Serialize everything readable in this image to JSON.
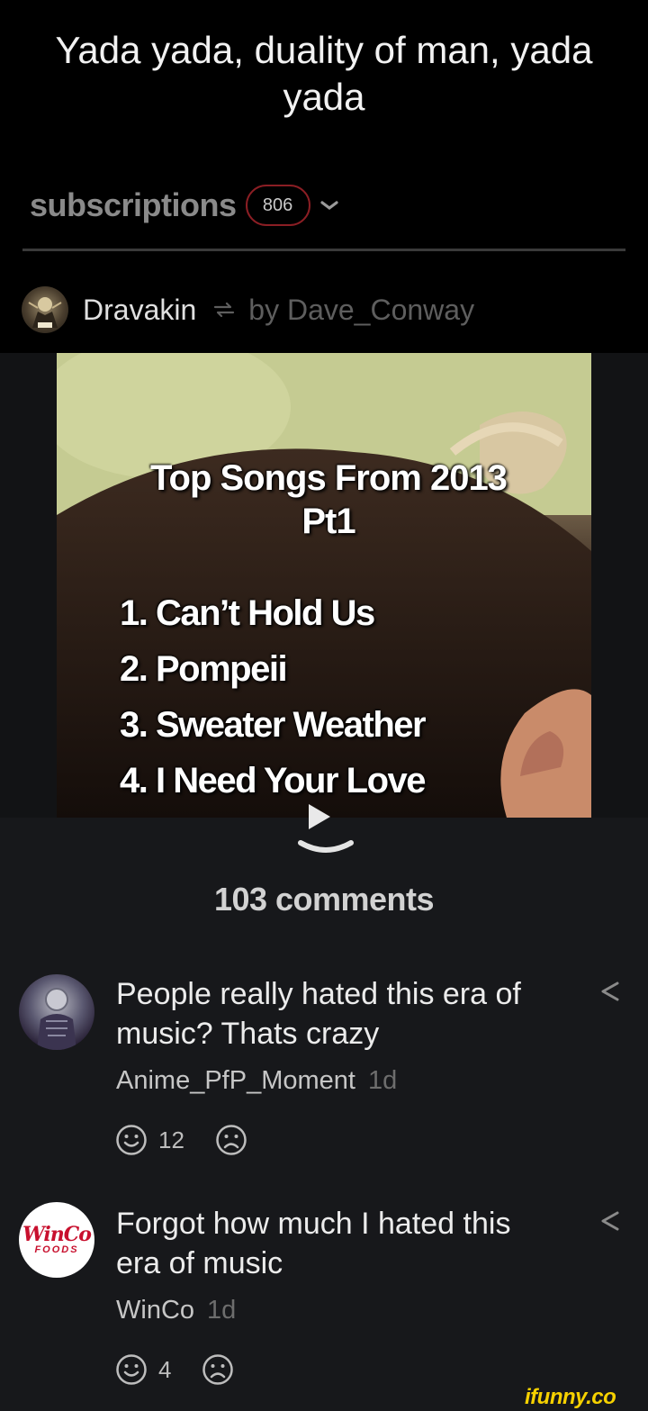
{
  "post": {
    "title": "Yada yada, duality of man, yada yada",
    "author": "Dravakin",
    "reposted_by": "by Dave_Conway"
  },
  "subscriptions": {
    "label": "subscriptions",
    "count": "806"
  },
  "media": {
    "overlay_title": "Top Songs From 2013 Pt1",
    "songs": [
      "1. Can’t Hold Us",
      "2. Pompeii",
      "3. Sweater Weather",
      "4. I Need Your Love"
    ]
  },
  "comments_header": "103 comments",
  "comments": [
    {
      "text": "People really hated this era of music? Thats crazy",
      "user": "Anime_PfP_Moment",
      "time": "1d",
      "smiles": "12"
    },
    {
      "text": "Forgot how much I hated this era of music",
      "user": "WinCo",
      "time": "1d",
      "smiles": "4",
      "avatar_logo_main": "WinCo",
      "avatar_logo_sub": "FOODS"
    }
  ],
  "watermark": "ifunny.co",
  "colors": {
    "accent_badge": "#8b1e24",
    "watermark": "#f6d100",
    "winco_red": "#c8102e"
  }
}
